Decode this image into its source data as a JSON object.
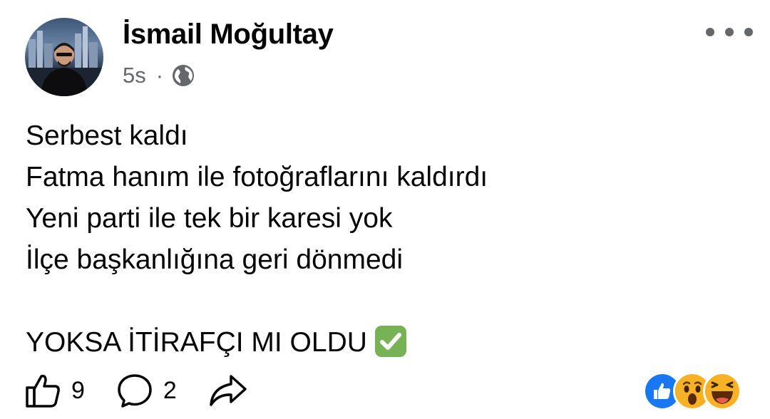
{
  "author": {
    "name": "İsmail Moğultay",
    "avatar_icon": "profile-photo"
  },
  "meta": {
    "time": "5s",
    "separator": "·",
    "privacy_icon": "globe-icon"
  },
  "post": {
    "lines": [
      "Serbest kaldı",
      "Fatma hanım ile fotoğraflarını kaldırdı",
      "Yeni parti ile tek bir karesi yok",
      "İlçe başkanlığına geri dönmedi",
      "",
      "YOKSA İTİRAFÇI MI OLDU"
    ],
    "emoji_icon": "check-mark-button-icon"
  },
  "actions": {
    "like_count": "9",
    "comment_count": "2",
    "like_icon": "thumbs-up-outline-icon",
    "comment_icon": "comment-bubble-icon",
    "share_icon": "share-arrow-icon"
  },
  "reactions": [
    "like",
    "wow",
    "haha"
  ],
  "colors": {
    "text": "#050505",
    "secondary_text": "#65676b",
    "like_blue": "#1877f2",
    "reaction_yellow": "#f7b125",
    "check_green": "#77b255"
  }
}
